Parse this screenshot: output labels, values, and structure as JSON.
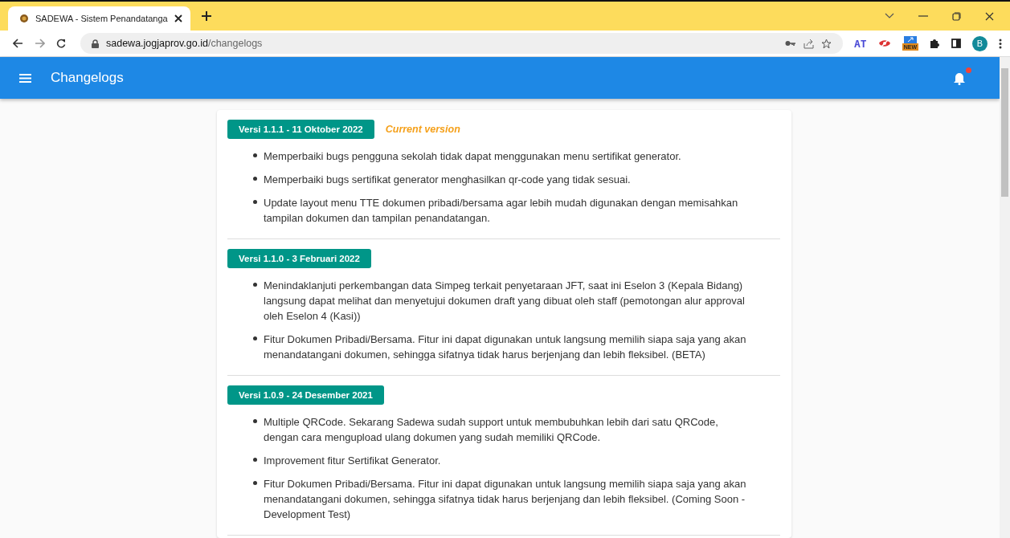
{
  "browser": {
    "tab_title": "SADEWA - Sistem Penandatanga",
    "url_host": "sadewa.jogjaprov.go.id",
    "url_path": "/changelogs",
    "extension_text": "AT",
    "new_badge": "NEW",
    "profile_initial": "B"
  },
  "app_bar": {
    "title": "Changelogs",
    "has_notification": true
  },
  "releases": [
    {
      "version": "Versi 1.1.1 - 11 Oktober 2022",
      "current_label": "Current version",
      "items": [
        "Memperbaiki bugs pengguna sekolah tidak dapat menggunakan menu sertifikat generator.",
        "Memperbaiki bugs sertifikat generator menghasilkan qr-code yang tidak sesuai.",
        "Update layout menu TTE dokumen pribadi/bersama agar lebih mudah digunakan dengan memisahkan tampilan dokumen dan tampilan penandatangan."
      ]
    },
    {
      "version": "Versi 1.1.0 - 3 Februari 2022",
      "items": [
        "Menindaklanjuti perkembangan data Simpeg terkait penyetaraan JFT, saat ini Eselon 3 (Kepala Bidang) langsung dapat melihat dan menyetujui dokumen draft yang dibuat oleh staff (pemotongan alur approval oleh Eselon 4 (Kasi))",
        "Fitur Dokumen Pribadi/Bersama. Fitur ini dapat digunakan untuk langsung memilih siapa saja yang akan menandatangani dokumen, sehingga sifatnya tidak harus berjenjang dan lebih fleksibel. (BETA)"
      ]
    },
    {
      "version": "Versi 1.0.9 - 24 Desember 2021",
      "items": [
        "Multiple QRCode. Sekarang Sadewa sudah support untuk membubuhkan lebih dari satu QRCode, dengan cara mengupload ulang dokumen yang sudah memiliki QRCode.",
        "Improvement fitur Sertifikat Generator.",
        "Fitur Dokumen Pribadi/Bersama. Fitur ini dapat digunakan untuk langsung memilih siapa saja yang akan menandatangani dokumen, sehingga sifatnya tidak harus berjenjang dan lebih fleksibel. (Coming Soon - Development Test)"
      ]
    }
  ]
}
